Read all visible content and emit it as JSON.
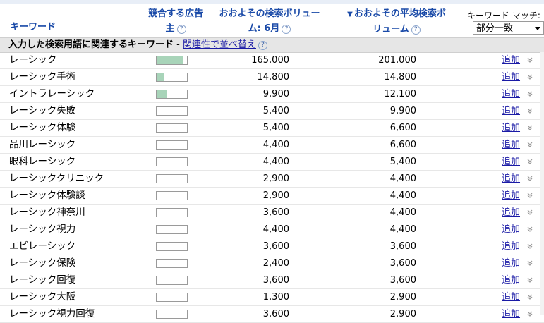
{
  "header": {
    "keyword_label": "キーワード",
    "competition_line1": "競合する広告",
    "competition_line2": "主",
    "volume_line1": "おおよその検索ボリュー",
    "volume_line2": "ム: 6月",
    "average_arrow": "▼",
    "average_line1": "おおよその平均検索ボ",
    "average_line2": "リューム",
    "help_glyph": "?",
    "match_label": "キーワード マッチ:",
    "match_value": "部分一致"
  },
  "section": {
    "title": "入力した検索用語に関連するキーワード",
    "separator": " - ",
    "sort_link": "関連性で並べ替え"
  },
  "colors": {
    "link": "#1a1aa6",
    "header_text": "#1a4aa8",
    "bar_fill": "#a8d4b9"
  },
  "rows": [
    {
      "keyword": "レーシック",
      "competition": 0.85,
      "volume": "165,000",
      "average": "201,000",
      "add": "追加"
    },
    {
      "keyword": "レーシック手術",
      "competition": 0.25,
      "volume": "14,800",
      "average": "14,800",
      "add": "追加"
    },
    {
      "keyword": "イントラレーシック",
      "competition": 0.32,
      "volume": "9,900",
      "average": "12,100",
      "add": "追加"
    },
    {
      "keyword": "レーシック失敗",
      "competition": 0,
      "volume": "5,400",
      "average": "9,900",
      "add": "追加"
    },
    {
      "keyword": "レーシック体験",
      "competition": 0,
      "volume": "5,400",
      "average": "6,600",
      "add": "追加"
    },
    {
      "keyword": "品川レーシック",
      "competition": 0,
      "volume": "4,400",
      "average": "6,600",
      "add": "追加"
    },
    {
      "keyword": "眼科レーシック",
      "competition": 0,
      "volume": "4,400",
      "average": "5,400",
      "add": "追加"
    },
    {
      "keyword": "レーシッククリニック",
      "competition": 0,
      "volume": "2,900",
      "average": "4,400",
      "add": "追加"
    },
    {
      "keyword": "レーシック体験談",
      "competition": 0,
      "volume": "2,900",
      "average": "4,400",
      "add": "追加"
    },
    {
      "keyword": "レーシック神奈川",
      "competition": 0,
      "volume": "3,600",
      "average": "4,400",
      "add": "追加"
    },
    {
      "keyword": "レーシック視力",
      "competition": 0,
      "volume": "4,400",
      "average": "4,400",
      "add": "追加"
    },
    {
      "keyword": "エピレーシック",
      "competition": 0,
      "volume": "3,600",
      "average": "3,600",
      "add": "追加"
    },
    {
      "keyword": "レーシック保険",
      "competition": 0,
      "volume": "2,400",
      "average": "3,600",
      "add": "追加"
    },
    {
      "keyword": "レーシック回復",
      "competition": 0,
      "volume": "3,600",
      "average": "3,600",
      "add": "追加"
    },
    {
      "keyword": "レーシック大阪",
      "competition": 0,
      "volume": "1,300",
      "average": "2,900",
      "add": "追加"
    },
    {
      "keyword": "レーシック視力回復",
      "competition": 0,
      "volume": "3,600",
      "average": "2,900",
      "add": "追加"
    }
  ]
}
